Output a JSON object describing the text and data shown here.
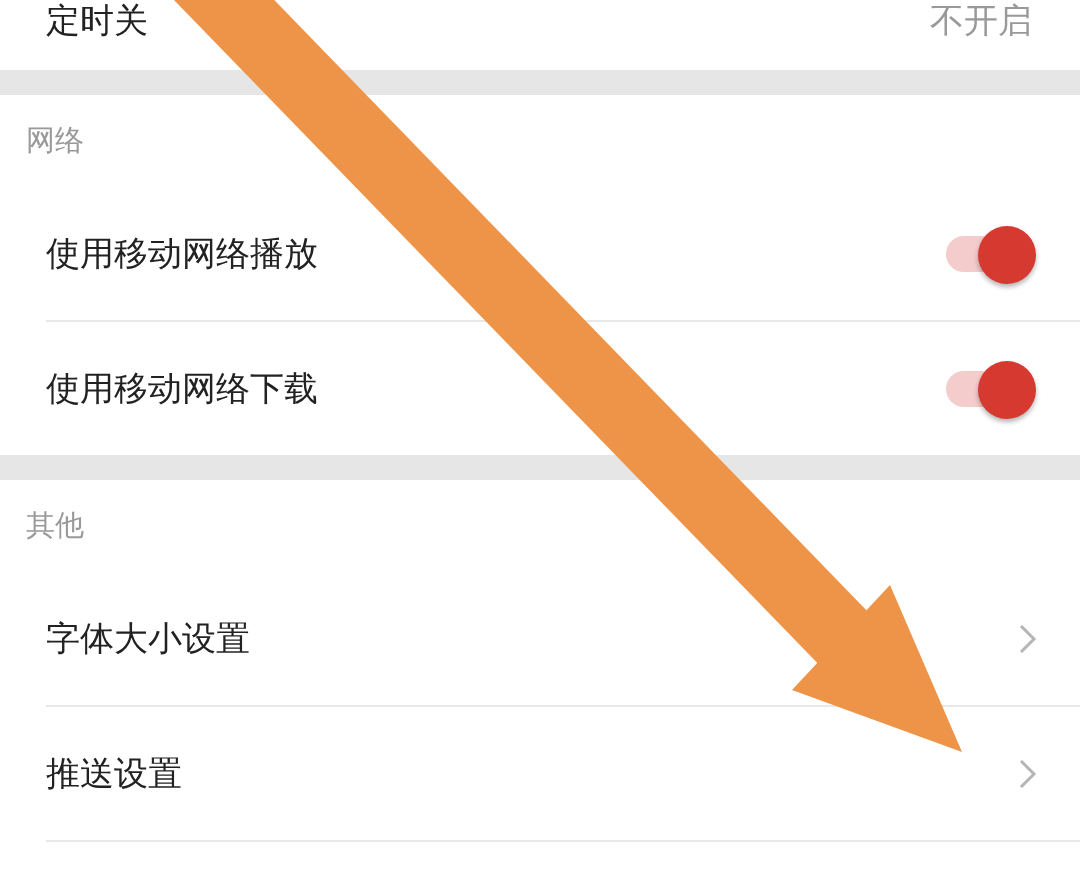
{
  "top_row": {
    "label": "定时关",
    "value": "不开启"
  },
  "sections": [
    {
      "header": "网络",
      "items": [
        {
          "kind": "toggle",
          "label": "使用移动网络播放",
          "on": true
        },
        {
          "kind": "toggle",
          "label": "使用移动网络下载",
          "on": true
        }
      ]
    },
    {
      "header": "其他",
      "items": [
        {
          "kind": "link",
          "label": "字体大小设置"
        },
        {
          "kind": "link",
          "label": "推送设置"
        }
      ]
    }
  ]
}
